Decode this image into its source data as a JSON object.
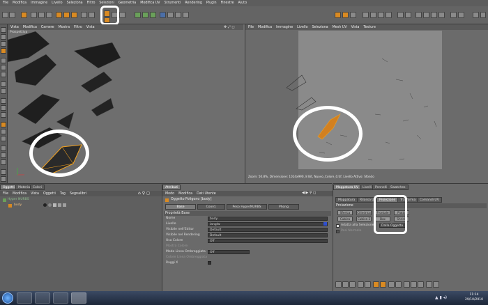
{
  "menubar": {
    "items": [
      "File",
      "Modifica",
      "Immagine",
      "Livello",
      "Seleziona",
      "Filtro",
      "Selezioni",
      "Geometria",
      "Modifica UV",
      "Strumenti",
      "Rendering",
      "Plugin",
      "Finestre",
      "Aiuto"
    ]
  },
  "viewport": {
    "menu": [
      "Vista",
      "Modifica",
      "Camere",
      "Mostra",
      "Filtro",
      "Vista"
    ],
    "label": "Prospettiva"
  },
  "uv_editor": {
    "menu": [
      "File",
      "Modifica",
      "Immagine",
      "Livello",
      "Seleziona",
      "Mesh UV",
      "Vista",
      "Texture"
    ],
    "status": "Zoom: 50.8%, Dimensione: 1024x990, 8 Bit, Nuovo_Colore_0.tif, Livello Attivo: Sfondo"
  },
  "objects": {
    "tabs": [
      "Oggetti",
      "Materiali",
      "Colori"
    ],
    "menu": [
      "File",
      "Modifica",
      "Vista",
      "Oggetti",
      "Tag",
      "Segnalibri"
    ],
    "items": [
      "Hyper NURBS",
      "body"
    ]
  },
  "attributes": {
    "tab": "Attributi",
    "menu": [
      "Modo",
      "Modifica",
      "Dati Utente"
    ],
    "title": "Oggetto Poligono [body]",
    "subtabs": [
      "Base",
      "Coord.",
      "Peso HyperNURBS",
      "Phong"
    ],
    "section": "Proprietà Base",
    "props": [
      {
        "label": "Nome",
        "value": "body"
      },
      {
        "label": "Livello",
        "value": "ianglw"
      },
      {
        "label": "Visibile nell'Editor",
        "value": "Default"
      },
      {
        "label": "Visibile nel Rendering",
        "value": "Default"
      },
      {
        "label": "Usa Colore",
        "value": "Off"
      },
      {
        "label": "Mostra Colore",
        "value": ""
      },
      {
        "label": "Modo Linea Ombreggiata",
        "value": "Off"
      },
      {
        "label": "Colore Linea Ombreggiata",
        "value": ""
      },
      {
        "label": "Raggi X",
        "value": ""
      }
    ]
  },
  "uv_mapping": {
    "tabs": [
      "Mappatura UV",
      "Livelli",
      "Pennelli",
      "Swatches"
    ],
    "subtabs": [
      "Mappatura",
      "Rilassa UV",
      "Proiezione",
      "Trasforma",
      "Comandi UV"
    ],
    "section": "Proiezione",
    "buttons": [
      "Sferica",
      "Cilindrica",
      "Frontale",
      "Piatta",
      "Cubica",
      "Cubica 2",
      "Box",
      "Shrink"
    ],
    "checkbox1": "Adatta alla Selezione",
    "dropdown": "Dalla Oggetto",
    "checkbox2": "Pesi Normale"
  },
  "taskbar": {
    "time": "11:14",
    "date": "29/10/2010"
  }
}
